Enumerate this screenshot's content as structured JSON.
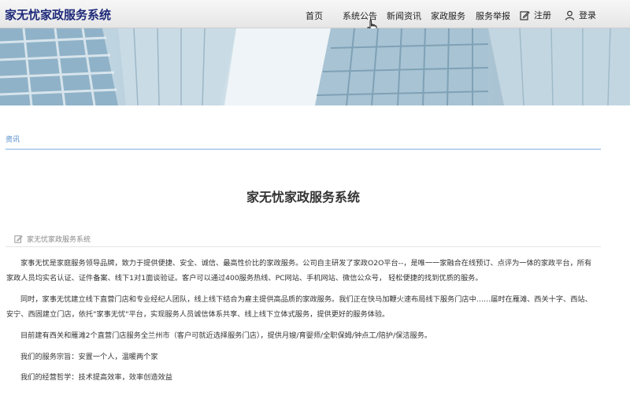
{
  "header": {
    "brand": "家无忧家政服务系统",
    "nav": [
      "首页",
      "系统公告",
      "新闻资讯",
      "家政服务",
      "服务举报"
    ],
    "register": "注册",
    "login": "登录"
  },
  "section": {
    "label": "资讯"
  },
  "article": {
    "title": "家无忧家政服务系统",
    "meta": "家无忧家政服务系统",
    "paragraphs": [
      "家事无忧是家庭服务领导品牌，致力于提供便捷、安全、诚信、最高性价比的家政服务。公司自主研发了家政O2O平台--，是唯一一家融合在线预订、点评为一体的家政平台，所有",
      "家政人员均实名认证、证件备案、线下1对1面谈验证。客户可以通过400服务热线、PC网站、手机网站、微信公众号， 轻松便捷的找到优质的服务。",
      "同时，家事无忧建立线下直营门店和专业经纪人团队，线上线下结合为雇主提供高品质的家政服务。我们正在快马加鞭火速布局线下服务门店中……届时在雁滩、西关十字、西站、",
      "安宁、西固建立门店，依托\"家事无忧\"平台，实现服务人员诚信体系共享、线上线下立体式服务，提供更好的服务体验。",
      "目前建有西关和雁滩2个直营门店服务全兰州市（客户可就近选择服务门店），提供月嫂/育婴师/全职保姆/钟点工/陪护/保洁服务。",
      "我们的服务宗旨：安置一个人，温暖两个家",
      "我们的经营哲学：技术提高效率，效率创造效益"
    ]
  }
}
